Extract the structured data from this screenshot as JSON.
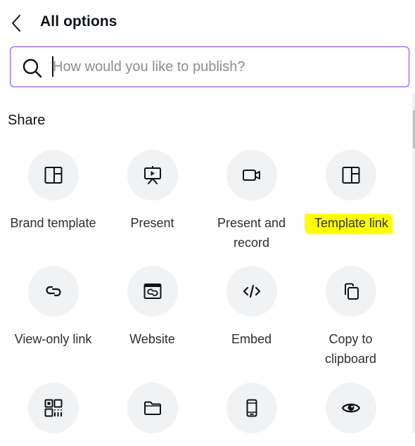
{
  "header": {
    "back_icon": "chevron-left-icon",
    "title": "All options"
  },
  "search": {
    "icon": "search-icon",
    "value": "",
    "placeholder": "How would you like to publish?"
  },
  "sections": [
    {
      "title": "Share",
      "options": [
        {
          "label": "Brand template",
          "icon": "layout-template-icon",
          "highlighted": false
        },
        {
          "label": "Present",
          "icon": "presentation-screen-icon",
          "highlighted": false
        },
        {
          "label": "Present and record",
          "icon": "video-camera-icon",
          "highlighted": false
        },
        {
          "label": "Template link",
          "icon": "layout-template-icon",
          "highlighted": true
        },
        {
          "label": "View-only link",
          "icon": "link-icon",
          "highlighted": false
        },
        {
          "label": "Website",
          "icon": "website-link-icon",
          "highlighted": false
        },
        {
          "label": "Embed",
          "icon": "code-icon",
          "highlighted": false
        },
        {
          "label": "Copy to clipboard",
          "icon": "copy-icon",
          "highlighted": false
        },
        {
          "label": "",
          "icon": "qr-code-icon",
          "highlighted": false
        },
        {
          "label": "",
          "icon": "folder-icon",
          "highlighted": false
        },
        {
          "label": "",
          "icon": "mobile-phone-icon",
          "highlighted": false
        },
        {
          "label": "",
          "icon": "eye-icon",
          "highlighted": false
        }
      ]
    }
  ],
  "colors": {
    "accent": "#8b3dff",
    "highlight": "#ffff00",
    "icon_bg": "#f1f2f4"
  }
}
